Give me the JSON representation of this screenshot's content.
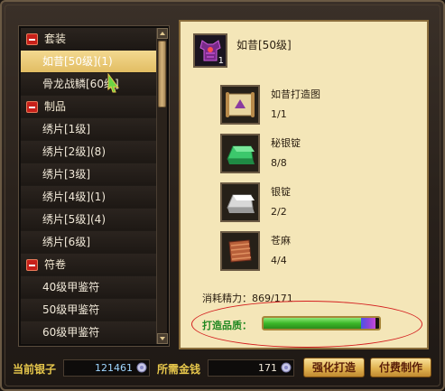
{
  "list": {
    "rows": [
      {
        "type": "category",
        "label": "套装"
      },
      {
        "type": "item",
        "label": "如昔[50级](1)",
        "selected": true
      },
      {
        "type": "item",
        "label": "骨龙战鳞[60级]"
      },
      {
        "type": "category",
        "label": "制品"
      },
      {
        "type": "item",
        "label": "绣片[1级]"
      },
      {
        "type": "item",
        "label": "绣片[2级](8)"
      },
      {
        "type": "item",
        "label": "绣片[3级]"
      },
      {
        "type": "item",
        "label": "绣片[4级](1)"
      },
      {
        "type": "item",
        "label": "绣片[5级](4)"
      },
      {
        "type": "item",
        "label": "绣片[6级]"
      },
      {
        "type": "category",
        "label": "符卷"
      },
      {
        "type": "item",
        "label": "40级甲鉴符"
      },
      {
        "type": "item",
        "label": "50级甲鉴符"
      },
      {
        "type": "item",
        "label": "60级甲鉴符"
      }
    ]
  },
  "product": {
    "name": "如昔[50级]",
    "quantity": "1",
    "icon": "armor-icon"
  },
  "materials": [
    {
      "name": "如昔打造图",
      "count": "1/1",
      "icon": "scroll-blueprint-icon"
    },
    {
      "name": "秘银锭",
      "count": "8/8",
      "icon": "green-ingot-icon"
    },
    {
      "name": "银锭",
      "count": "2/2",
      "icon": "silver-ingot-icon"
    },
    {
      "name": "苍麻",
      "count": "4/4",
      "icon": "hemp-icon"
    }
  ],
  "energy_text": "消耗精力：869/171",
  "quality": {
    "label": "打造品质：",
    "main_fraction": 0.84,
    "extra_fraction": 0.13
  },
  "footer": {
    "silver_label": "当前银子",
    "silver_value": "121461",
    "need_label": "所需金钱",
    "need_value": "171",
    "enhance_button": "强化打造",
    "paid_button": "付费制作"
  },
  "colors": {
    "selected_row": "#e2bd63",
    "quality_text": "#208820",
    "highlight_ellipse": "#d42020"
  }
}
